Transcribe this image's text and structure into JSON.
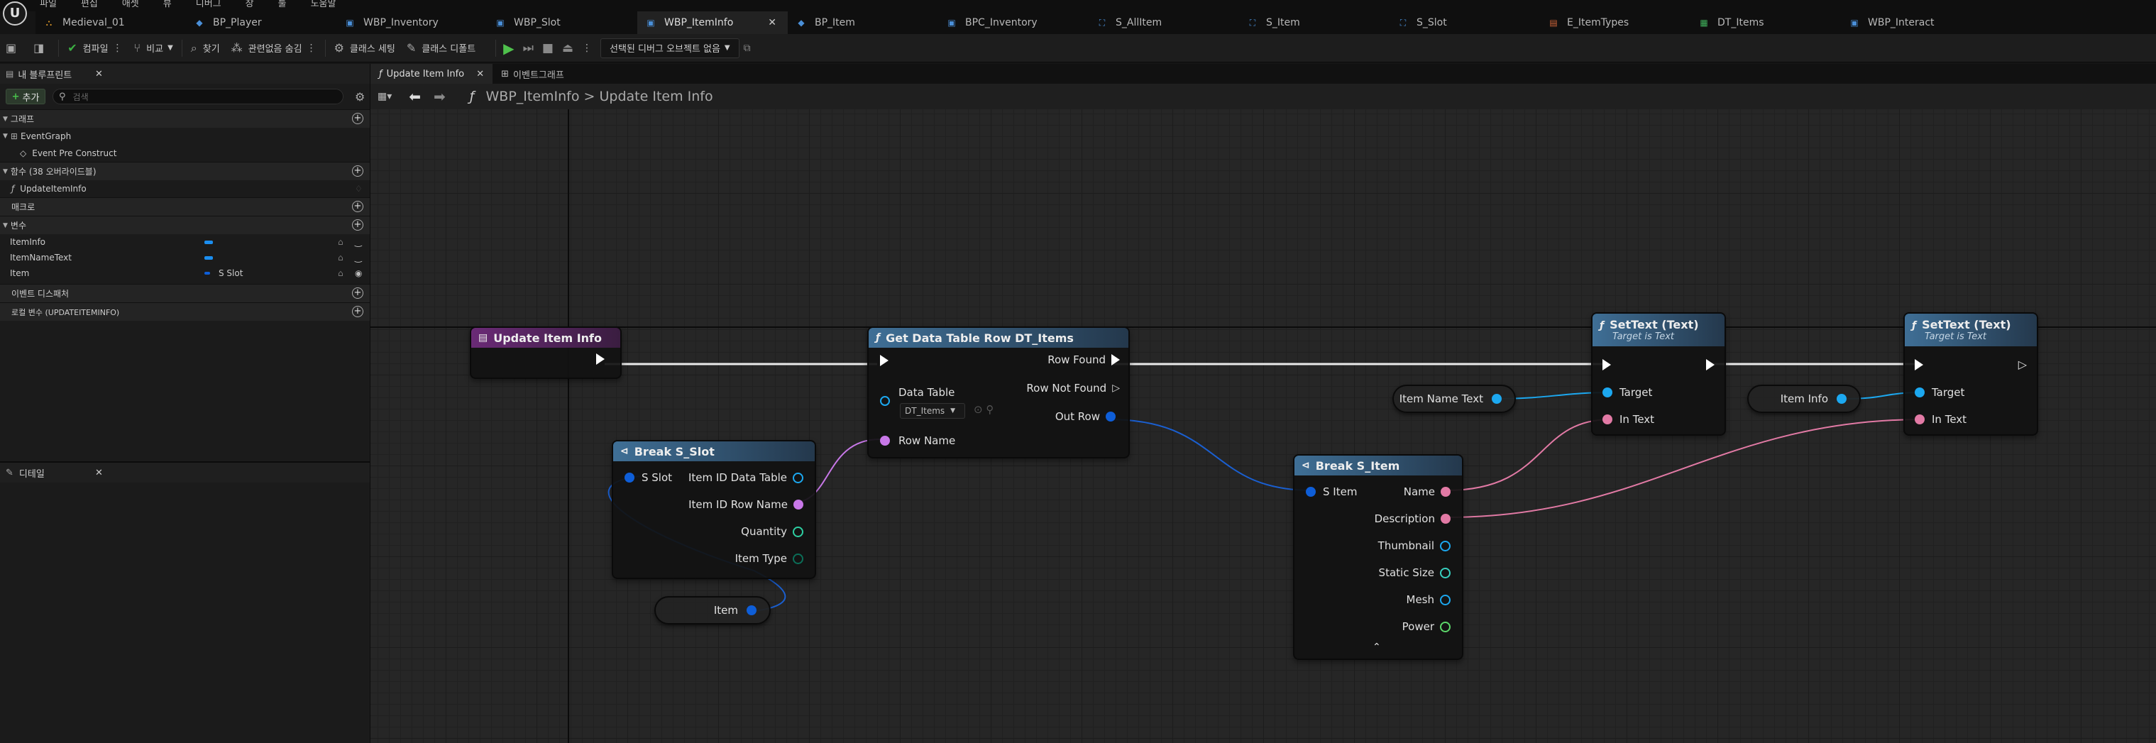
{
  "menu": [
    "파일",
    "편집",
    "애셋",
    "뷰",
    "디버그",
    "창",
    "툴",
    "도움말"
  ],
  "doc_tabs": [
    {
      "label": "Medieval_01",
      "icon": "level-icon",
      "color": "#e09a2a"
    },
    {
      "label": "BP_Player",
      "icon": "blueprint-icon",
      "color": "#4a8fd8"
    },
    {
      "label": "WBP_Inventory",
      "icon": "widget-blueprint-icon",
      "color": "#4a8fd8"
    },
    {
      "label": "WBP_Slot",
      "icon": "widget-blueprint-icon",
      "color": "#4a8fd8"
    },
    {
      "label": "WBP_ItemInfo",
      "icon": "widget-blueprint-icon",
      "color": "#4a8fd8",
      "active": true
    },
    {
      "label": "BP_Item",
      "icon": "blueprint-icon",
      "color": "#4a8fd8"
    },
    {
      "label": "BPC_Inventory",
      "icon": "component-icon",
      "color": "#4a8fd8"
    },
    {
      "label": "S_AllItem",
      "icon": "struct-icon",
      "color": "#4a8fd8"
    },
    {
      "label": "S_Item",
      "icon": "struct-icon",
      "color": "#4a8fd8"
    },
    {
      "label": "S_Slot",
      "icon": "struct-icon",
      "color": "#4a8fd8"
    },
    {
      "label": "E_ItemTypes",
      "icon": "enum-icon",
      "color": "#d0663a"
    },
    {
      "label": "DT_Items",
      "icon": "datatable-icon",
      "color": "#3fae5a"
    },
    {
      "label": "WBP_Interact",
      "icon": "widget-blueprint-icon",
      "color": "#4a8fd8"
    }
  ],
  "toolbar": {
    "compile": "컴파일",
    "diff": "비교",
    "find": "찾기",
    "hide_unrelated": "관련없음 숨김",
    "class_settings": "클래스 세팅",
    "class_defaults": "클래스 디폴트",
    "debug_object": "선택된 디버그 오브젝트 없음"
  },
  "left_panel": {
    "tab": "내 블루프린트",
    "add": "추가",
    "search_placeholder": "검색",
    "graphs_header": "그래프",
    "event_graph": "EventGraph",
    "event_pre_construct": "Event Pre Construct",
    "functions_header": "함수 (38 오버라이드블)",
    "function_item": "UpdateItemInfo",
    "macros_header": "매크로",
    "variables_header": "변수",
    "variables": [
      {
        "name": "ItemInfo",
        "type": ""
      },
      {
        "name": "ItemNameText",
        "type": ""
      },
      {
        "name": "Item",
        "type": "S Slot"
      }
    ],
    "event_dispatchers": "이벤트 디스패처",
    "local_vars": "로컬 변수 (UPDATEITEMINFO)"
  },
  "details": {
    "tab": "디테일"
  },
  "graph_tabs": [
    "Update Item Info",
    "이벤트그래프"
  ],
  "breadcrumb": {
    "root": "WBP_ItemInfo",
    "sep": ">",
    "current": "Update Item Info"
  },
  "nodes": {
    "entry": {
      "title": "Update Item Info"
    },
    "get_row": {
      "title": "Get Data Table Row DT_Items",
      "row_found": "Row Found",
      "row_not_found": "Row Not Found",
      "data_table": "Data Table",
      "dt_value": "DT_Items",
      "row_name": "Row Name",
      "out_row": "Out Row"
    },
    "break_slot": {
      "title": "Break S_Slot",
      "in": "S Slot",
      "pins": [
        "Item ID Data Table",
        "Item ID Row Name",
        "Quantity",
        "Item Type"
      ]
    },
    "item_var": {
      "label": "Item"
    },
    "break_item": {
      "title": "Break S_Item",
      "in": "S Item",
      "pins": [
        "Name",
        "Description",
        "Thumbnail",
        "Static Size",
        "Mesh",
        "Power"
      ]
    },
    "item_name_text": {
      "label": "Item Name Text"
    },
    "item_info": {
      "label": "Item Info"
    },
    "settext1": {
      "title": "SetText (Text)",
      "subtitle": "Target is Text",
      "target": "Target",
      "in_text": "In Text"
    },
    "settext2": {
      "title": "SetText (Text)",
      "subtitle": "Target is Text",
      "target": "Target",
      "in_text": "In Text"
    }
  },
  "colors": {
    "struct_pin": "#0e5ed8",
    "name_pin": "#c878e8",
    "text_pin": "#e27aa5",
    "object_pin": "#1ca8f0",
    "int_pin": "#2ecfa2",
    "enum_pin": "#0b6e58",
    "vector_pin": "#38d0c0",
    "float_pin": "#5cd86a",
    "function_header": "#3f6f96",
    "event_header": "#6a2a76"
  }
}
